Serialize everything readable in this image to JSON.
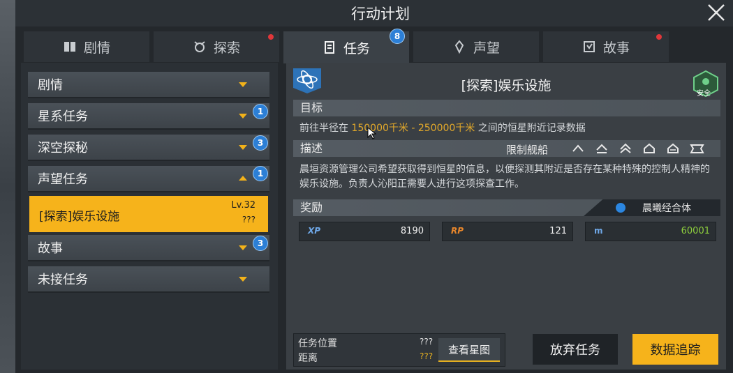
{
  "window": {
    "title": "行动计划"
  },
  "tabs": [
    {
      "label": "剧情",
      "icon": "book-icon"
    },
    {
      "label": "探索",
      "icon": "explore-icon"
    },
    {
      "label": "任务",
      "icon": "clipboard-icon",
      "badge": "8",
      "active": true
    },
    {
      "label": "声望",
      "icon": "reputation-icon"
    },
    {
      "label": "故事",
      "icon": "story-icon"
    }
  ],
  "sidebar": {
    "items": [
      {
        "label": "剧情"
      },
      {
        "label": "星系任务",
        "badge": "1"
      },
      {
        "label": "深空探秘",
        "badge": "3"
      },
      {
        "label": "声望任务",
        "badge": "1"
      },
      {
        "label": "故事",
        "badge": "3"
      },
      {
        "label": "未接任务"
      }
    ],
    "selected": {
      "label": "[探索]娱乐设施",
      "level": "Lv.32",
      "unknown": "???"
    }
  },
  "quest": {
    "title": "[探索]娱乐设施",
    "safe_label": "安全",
    "objective_head": "目标",
    "objective_prefix": "前往半径在",
    "objective_range": "150000千米 - 250000千米",
    "objective_suffix": "之间的恒星附近记录数据",
    "desc_head": "描述",
    "restrict_label": "限制舰船",
    "description": "晨垣资源管理公司希望获取得到恒星的信息，以便探测其附近是否存在某种特殊的控制人精神的娱乐设施。负责人沁阳正需要人进行这项探查工作。",
    "reward_head": "奖励",
    "faction": "晨曦经合体",
    "rewards": {
      "xp_label": "XP",
      "xp_value": "8190",
      "rp_label": "RP",
      "rp_value": "121",
      "m_label": "m",
      "m_value": "60001"
    },
    "location_label": "任务位置",
    "location_value": "???",
    "distance_label": "距离",
    "distance_value": "???",
    "star_map_button": "查看星图",
    "abandon_button": "放弃任务",
    "track_button": "数据追踪"
  },
  "colors": {
    "accent": "#f6b31b",
    "badge": "#2c7fd6",
    "alert": "#e0373a"
  }
}
